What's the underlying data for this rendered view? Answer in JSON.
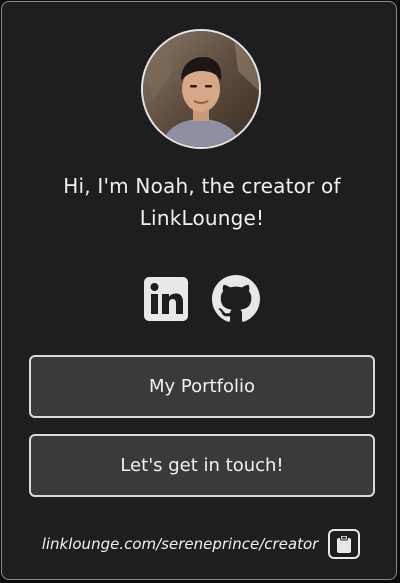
{
  "profile": {
    "avatar_icon": "profile-photo",
    "bio": "Hi, I'm Noah, the creator of LinkLounge!"
  },
  "socials": [
    {
      "name": "linkedin-icon"
    },
    {
      "name": "github-icon"
    }
  ],
  "buttons": {
    "portfolio_label": "My Portfolio",
    "contact_label": "Let's get in touch!"
  },
  "share": {
    "url": "linklounge.com/sereneprince/creator",
    "copy_icon": "clipboard-icon"
  },
  "colors": {
    "card_bg": "#1e1e1e",
    "button_bg": "#3a3a3a",
    "border": "#d9d9d9",
    "text": "#f1f1f1"
  }
}
